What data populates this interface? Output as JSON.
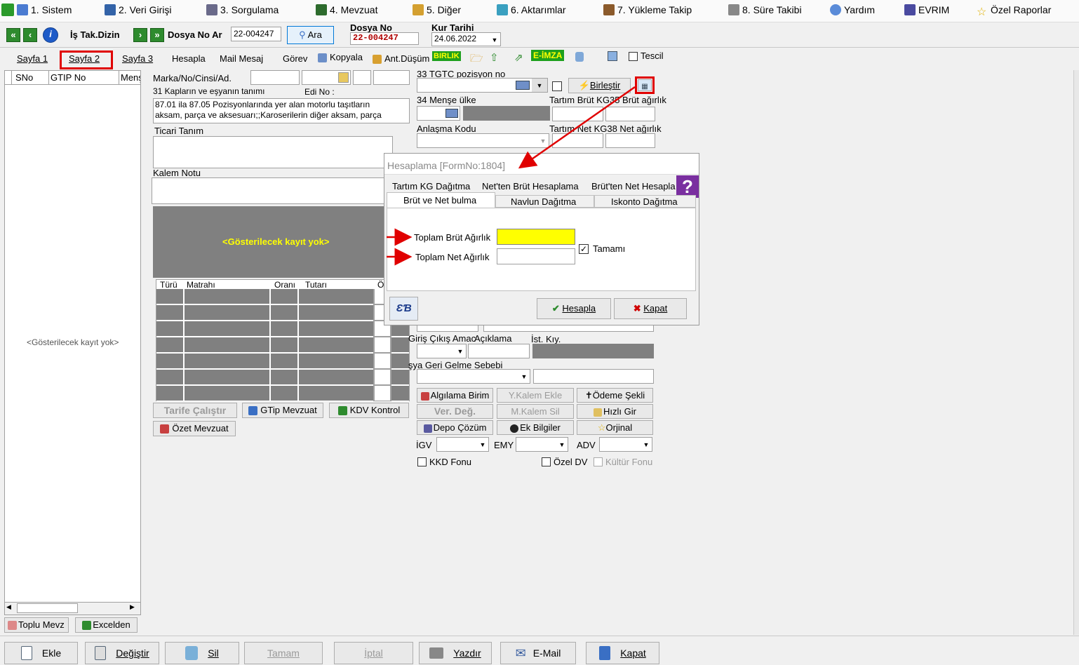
{
  "menu": [
    {
      "label": "1.  Sistem",
      "icon": "system-icon"
    },
    {
      "label": "2.  Veri Girişi",
      "icon": "data-entry-icon"
    },
    {
      "label": "3.  Sorgulama",
      "icon": "query-icon"
    },
    {
      "label": "4.  Mevzuat",
      "icon": "books-icon"
    },
    {
      "label": "5.  Diğer",
      "icon": "other-icon"
    },
    {
      "label": "6.  Aktarımlar",
      "icon": "transfer-icon"
    },
    {
      "label": "7.  Yükleme Takip",
      "icon": "loading-icon"
    },
    {
      "label": "8. Süre Takibi",
      "icon": "calendar-icon"
    },
    {
      "label": "Yardım",
      "icon": "help-icon"
    },
    {
      "label": "EVRIM",
      "icon": "evrim-icon"
    },
    {
      "label": "Özel Raporlar",
      "icon": "star-icon"
    }
  ],
  "toolbar": {
    "is_tak_dizin": "İş Tak.Dizin",
    "dosya_no_ara_label": "Dosya No Ar",
    "dosya_no_ara_value": "22-004247",
    "ara_button": "Ara",
    "dosya_no_label": "Dosya No",
    "dosya_no_value": "22-004247",
    "kur_tarihi_label": "Kur Tarihi",
    "kur_tarihi_value": "24.06.2022"
  },
  "tabs": {
    "sayfa1": "Sayfa 1",
    "sayfa2": "Sayfa 2",
    "sayfa3": "Sayfa 3",
    "hesapla": "Hesapla",
    "mail_mesaj": "Mail Mesaj",
    "gorev": "Görev",
    "kopyala": "Kopyala",
    "ant_dusum": "Ant.Düşüm",
    "birlik": "BIRLIK",
    "e_imza": "E-İMZA",
    "tescil": "Tescil"
  },
  "leftgrid": {
    "col_sno": "SNo",
    "col_gtip": "GTIP No",
    "col_mense": "Menş",
    "empty": "<Gösterilecek kayıt yok>",
    "toplu_mevz": "Toplu Mevz",
    "excelden": "Excelden"
  },
  "form": {
    "marka_label": "Marka/No/Cinsi/Ad.",
    "kaplar_label": "31 Kapların ve eşyanın tanımı",
    "edi_no_label": "Edi No :",
    "description_line1": "87.01 ila 87.05 Pozisyonlarında yer alan motorlu taşıtların",
    "description_line2": "aksam, parça ve aksesuarı;;Karoserilerin diğer aksam, parça",
    "ticari_tanim_label": "Ticari Tanım",
    "kalem_notu_label": "Kalem Notu",
    "empty_records": "<Gösterilecek kayıt yok>",
    "tax_cols": [
      "Türü",
      "Matrahı",
      "Oranı",
      "Tutarı",
      "Ö"
    ],
    "tarife_calistir": "Tarife Çalıştır",
    "gtip_mevzuat": "GTip Mevzuat",
    "kdv_kontrol": "KDV Kontrol",
    "ozet_mevzuat": "Özet Mevzuat",
    "tgtc_label": "33 TGTC pozisyon no",
    "birlestir": "Birleştir",
    "mense_label": "34 Menşe ülke",
    "brut_label": "Tartım Brüt KG35 Brüt ağırlık",
    "anlasma_label": "Anlaşma Kodu",
    "net_label": "Tartım Net KG38 Net ağırlık",
    "giris_cikis_label": "Giriş Çıkış Amac",
    "aciklama_label": "Açıklama",
    "ist_kiy_label": "İst. Kıy.",
    "geri_gelme_label": "şya Geri Gelme Sebebi",
    "algilama_birim": "Algılama Birim",
    "y_kalem_ekle": "Y.Kalem Ekle",
    "odeme_sekli": "Ödeme Şekli",
    "ver_deg": "Ver. Değ.",
    "m_kalem_sil": "M.Kalem Sil",
    "hizli_gir": "Hızlı Gir",
    "depo_cozum": "Depo Çözüm",
    "ek_bilgiler": "Ek Bilgiler",
    "orjinal": "Orjinal",
    "igv_label": "İGV",
    "emy_label": "EMY",
    "adv_label": "ADV",
    "kkd_fonu": "KKD Fonu",
    "ozel_dv": "Özel DV",
    "kultur_fonu": "Kültür Fonu"
  },
  "dialog": {
    "title": "Hesaplama [FormNo:1804]",
    "tabs_row1": [
      "Tartım KG Dağıtma",
      "Net'ten Brüt Hesaplama",
      "Brüt'ten Net Hesapla"
    ],
    "tabs_row2": [
      "Brüt ve Net bulma",
      "Navlun Dağıtma",
      "Iskonto Dağıtma"
    ],
    "toplam_brut": "Toplam Brüt Ağırlık",
    "toplam_net": "Toplam Net Ağırlık",
    "tamami": "Tamamı",
    "hesapla": "Hesapla",
    "kapat": "Kapat"
  },
  "bottom": {
    "ekle": "Ekle",
    "degistir": "Değiştir",
    "sil": "Sil",
    "tamam": "Tamam",
    "iptal": "İptal",
    "yazdir": "Yazdır",
    "email": "E-Mail",
    "kapat": "Kapat"
  },
  "colors": {
    "highlight_red": "#e00000",
    "yellow_field": "#ffff00",
    "grey_panel": "#808080",
    "empty_text_yellow": "#ffff00"
  }
}
